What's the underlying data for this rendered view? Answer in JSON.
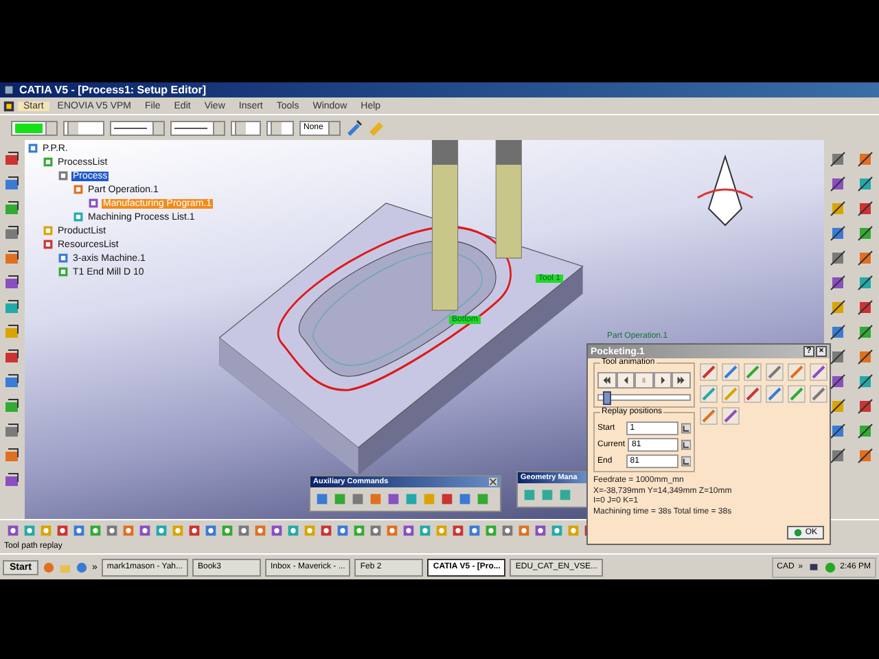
{
  "window": {
    "title": "CATIA V5 - [Process1: Setup Editor]"
  },
  "menu": [
    {
      "label": "Start",
      "selected": true
    },
    {
      "label": "ENOVIA V5 VPM",
      "selected": false
    },
    {
      "label": "File",
      "selected": false
    },
    {
      "label": "Edit",
      "selected": false
    },
    {
      "label": "View",
      "selected": false
    },
    {
      "label": "Insert",
      "selected": false
    },
    {
      "label": "Tools",
      "selected": false
    },
    {
      "label": "Window",
      "selected": false
    },
    {
      "label": "Help",
      "selected": false
    }
  ],
  "toolbar": {
    "line_type": "None"
  },
  "tree": [
    {
      "label": "P.P.R.",
      "selected": false,
      "highlighted": false,
      "children": [
        {
          "label": "ProcessList",
          "selected": false,
          "highlighted": false,
          "children": [
            {
              "label": "Process",
              "selected": true,
              "highlighted": false,
              "children": [
                {
                  "label": "Part Operation.1",
                  "selected": false,
                  "highlighted": false,
                  "children": [
                    {
                      "label": "Manufacturing Program.1",
                      "selected": false,
                      "highlighted": true
                    }
                  ]
                },
                {
                  "label": "Machining Process List.1",
                  "selected": false,
                  "highlighted": false
                }
              ]
            }
          ]
        },
        {
          "label": "ProductList",
          "selected": false,
          "highlighted": false
        },
        {
          "label": "ResourcesList",
          "selected": false,
          "highlighted": false,
          "children": [
            {
              "label": "3-axis Machine.1",
              "selected": false,
              "highlighted": false
            },
            {
              "label": "T1 End Mill D 10",
              "selected": false,
              "highlighted": false
            }
          ]
        }
      ]
    }
  ],
  "viewport": {
    "labels": [
      {
        "text": "Tool 1",
        "kind": "tag"
      },
      {
        "text": "Bottom",
        "kind": "tag"
      },
      {
        "text": "Part Operation.1",
        "kind": "faint"
      }
    ]
  },
  "auxiliary_toolbar": {
    "title": "Auxiliary Commands"
  },
  "geometry_toolbar": {
    "title": "Geometry Mana"
  },
  "dialog": {
    "title": "Pocketing.1",
    "help": "?",
    "close": "×",
    "animation": {
      "title": "Tool animation",
      "level": 0.05
    },
    "replay": {
      "title": "Replay positions",
      "fields": [
        {
          "label": "Start",
          "value": "1"
        },
        {
          "label": "Current",
          "value": "81"
        },
        {
          "label": "End",
          "value": "81"
        }
      ]
    },
    "info": [
      "Feedrate = 1000mm_mn",
      "X=-38,739mm Y=14,349mm Z=10mm",
      "I=0 J=0 K=1",
      "Machining time = 38s   Total time = 38s"
    ],
    "ok": "OK"
  },
  "status_bar": "Tool path replay",
  "taskbar": {
    "start": "Start",
    "more": "»",
    "tasks": [
      {
        "label": "mark1mason - Yah...",
        "selected": false
      },
      {
        "label": "Book3",
        "selected": false
      },
      {
        "label": "Inbox - Maverick - ...",
        "selected": false
      },
      {
        "label": "Feb 2",
        "selected": false
      },
      {
        "label": "CATIA V5 - [Pro...",
        "selected": true
      },
      {
        "label": "EDU_CAT_EN_VSE...",
        "selected": false
      }
    ],
    "tray_label": "CAD",
    "tray_more": "»",
    "clock": "2:46 PM"
  }
}
